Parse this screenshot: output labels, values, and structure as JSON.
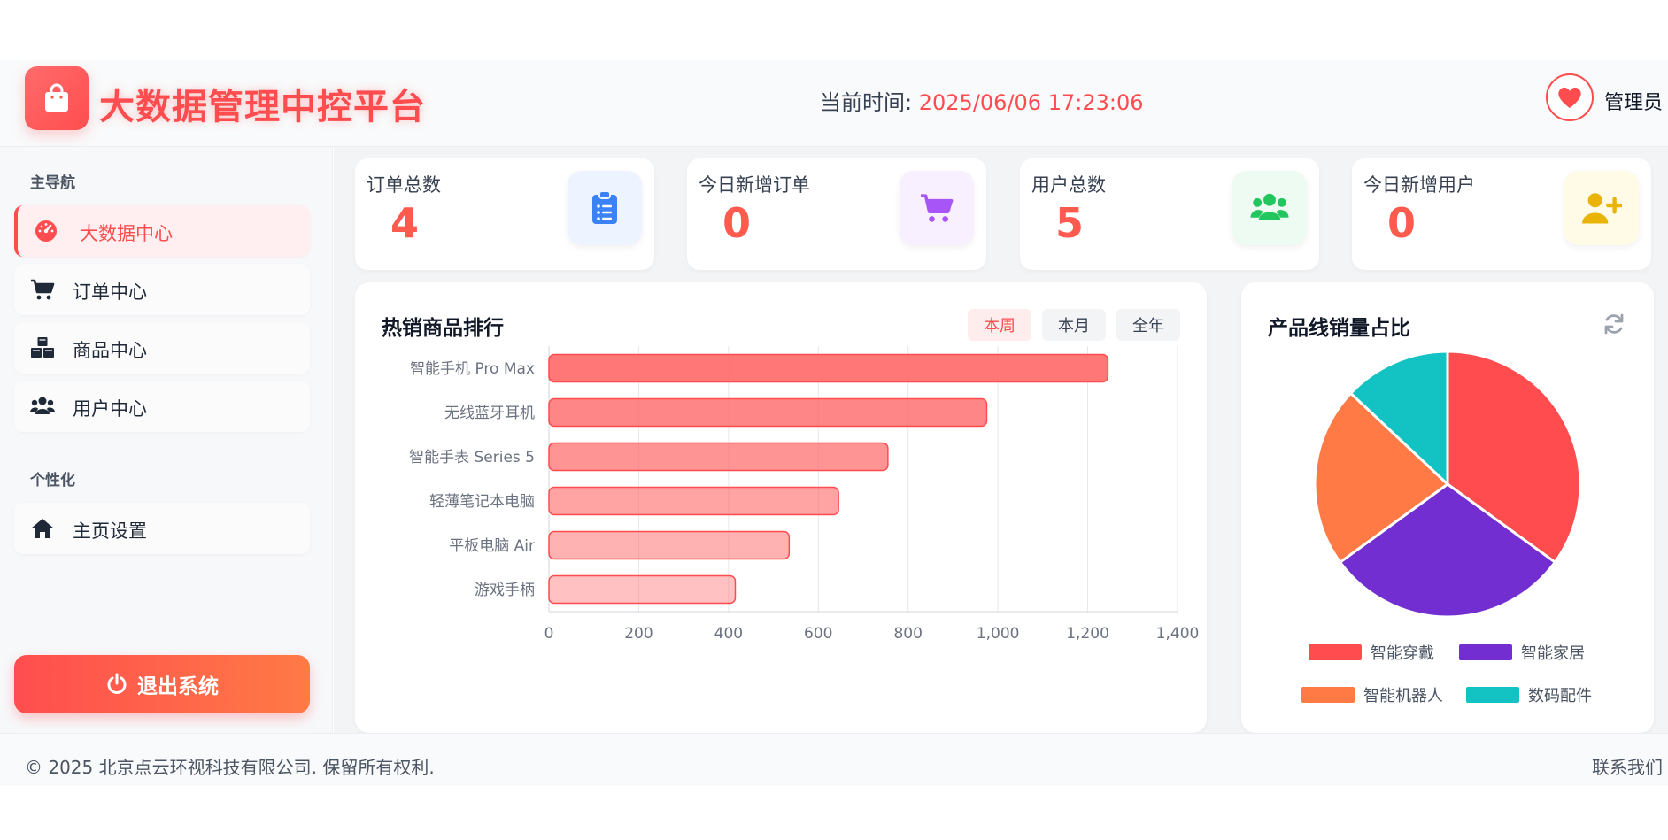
{
  "header": {
    "title": "大数据管理中控平台",
    "time_label": "当前时间:",
    "time_value": "2025/06/06 17:23:06",
    "admin_label": "管理员"
  },
  "sidebar": {
    "section_main": "主导航",
    "section_personal": "个性化",
    "items": [
      {
        "label": "大数据中心",
        "icon": "dashboard-icon",
        "active": true
      },
      {
        "label": "订单中心",
        "icon": "cart-icon",
        "active": false
      },
      {
        "label": "商品中心",
        "icon": "cubes-icon",
        "active": false
      },
      {
        "label": "用户中心",
        "icon": "users-icon",
        "active": false
      },
      {
        "label": "主页设置",
        "icon": "home-icon",
        "active": false
      }
    ],
    "logout_label": "退出系统"
  },
  "stats": [
    {
      "label": "订单总数",
      "value": "4",
      "icon": "clipboard-list-icon",
      "icon_color": "#3b82f6",
      "icon_bg": "#eef4ff"
    },
    {
      "label": "今日新增订单",
      "value": "0",
      "icon": "cart-icon",
      "icon_color": "#a855f7",
      "icon_bg": "#f8f0ff"
    },
    {
      "label": "用户总数",
      "value": "5",
      "icon": "users-icon",
      "icon_color": "#22c55e",
      "icon_bg": "#eefbf2"
    },
    {
      "label": "今日新增用户",
      "value": "0",
      "icon": "user-plus-icon",
      "icon_color": "#eab308",
      "icon_bg": "#fffbe6"
    }
  ],
  "bar_panel": {
    "title": "热销商品排行",
    "ranges": [
      {
        "label": "本周",
        "active": true
      },
      {
        "label": "本月",
        "active": false
      },
      {
        "label": "全年",
        "active": false
      }
    ]
  },
  "pie_panel": {
    "title": "产品线销量占比"
  },
  "chart_data": [
    {
      "type": "bar",
      "orientation": "horizontal",
      "categories": [
        "智能手机 Pro Max",
        "无线蓝牙耳机",
        "智能手表 Series 5",
        "轻薄笔记本电脑",
        "平板电脑 Air",
        "游戏手柄"
      ],
      "values": [
        1245,
        975,
        755,
        645,
        535,
        415
      ],
      "xlim": [
        0,
        1400
      ],
      "xticks": [
        "0",
        "200",
        "400",
        "600",
        "800",
        "1,000",
        "1,200",
        "1,400"
      ],
      "grid": true,
      "color": "#ff6b6b"
    },
    {
      "type": "pie",
      "labels": [
        "智能穿戴",
        "智能家居",
        "智能机器人",
        "数码配件"
      ],
      "values": [
        35,
        30,
        22,
        13
      ],
      "colors": [
        "#ff4d4f",
        "#722ed1",
        "#ff7a45",
        "#13c2c2"
      ],
      "legend_position": "bottom"
    }
  ],
  "footer": {
    "copyright": "© 2025 北京点云环视科技有限公司. 保留所有权利.",
    "contact": "联系我们"
  }
}
